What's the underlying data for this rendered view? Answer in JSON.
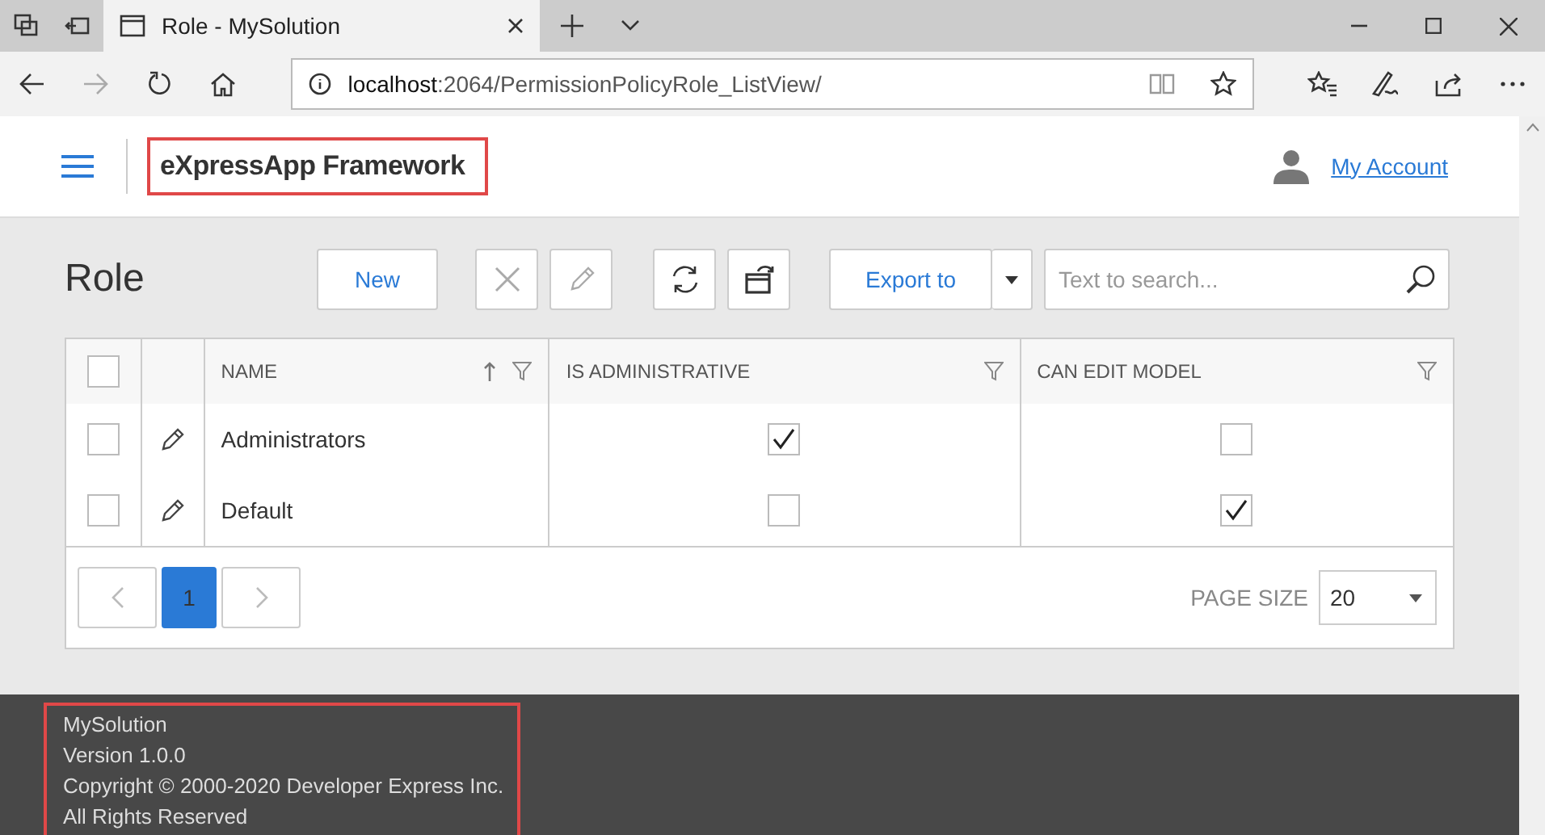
{
  "browser": {
    "tabs": [
      {
        "title": "Role - MySolution",
        "selected": true
      }
    ],
    "url_host": "localhost",
    "url_path": ":2064/PermissionPolicyRole_ListView/"
  },
  "header": {
    "title": "eXpressApp Framework",
    "account_link": "My Account"
  },
  "page": {
    "title": "Role",
    "new_button": "New",
    "export_button": "Export to",
    "search": {
      "placeholder": "Text to search..."
    }
  },
  "table": {
    "columns": [
      {
        "label": "NAME",
        "sorted_ascending": true
      },
      {
        "label": "IS ADMINISTRATIVE"
      },
      {
        "label": "CAN EDIT MODEL"
      }
    ],
    "all_selected": false,
    "rows": [
      {
        "name": "Administrators",
        "selected": false,
        "is_administrative": true,
        "can_edit_model": false
      },
      {
        "name": "Default",
        "selected": false,
        "is_administrative": false,
        "can_edit_model": true
      }
    ]
  },
  "pager": {
    "pages": [
      {
        "label": "1",
        "selected": true
      }
    ],
    "page_size_label": "PAGE SIZE",
    "page_size": "20"
  },
  "footer": {
    "lines": [
      "MySolution",
      "Version 1.0.0",
      "Copyright © 2000-2020 Developer Express Inc.",
      "All Rights Reserved"
    ]
  }
}
